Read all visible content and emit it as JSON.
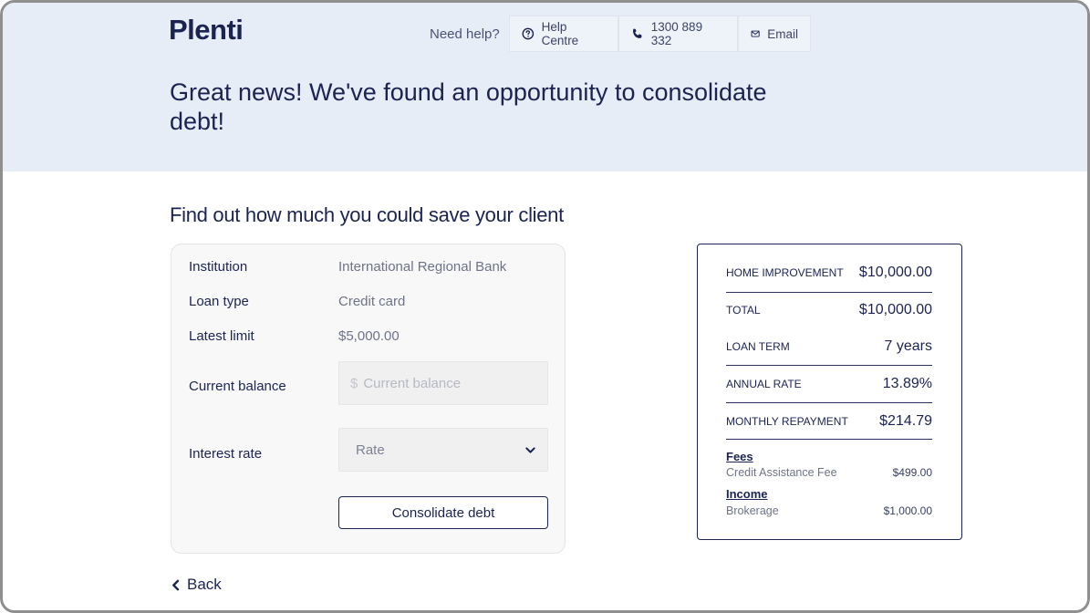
{
  "brand": {
    "logo": "Plenti"
  },
  "help": {
    "label": "Need help?",
    "help_centre": "Help Centre",
    "phone": "1300 889 332",
    "email": "Email"
  },
  "hero": {
    "title": "Great news! We've found an opportunity to consolidate debt!"
  },
  "section": {
    "title": "Find out how much you could save your client"
  },
  "form": {
    "institution_label": "Institution",
    "institution_value": "International Regional Bank",
    "loan_type_label": "Loan type",
    "loan_type_value": "Credit card",
    "latest_limit_label": "Latest limit",
    "latest_limit_value": "$5,000.00",
    "current_balance_label": "Current balance",
    "current_balance_prefix": "$",
    "current_balance_placeholder": "Current balance",
    "interest_rate_label": "Interest rate",
    "interest_rate_selected": "Rate",
    "consolidate_label": "Consolidate debt"
  },
  "back": {
    "label": "Back"
  },
  "summary": {
    "rows": [
      {
        "label": "HOME IMPROVEMENT",
        "value": "$10,000.00"
      },
      {
        "label": "TOTAL",
        "value": "$10,000.00"
      },
      {
        "label": "LOAN TERM",
        "value": "7 years"
      },
      {
        "label": "ANNUAL RATE",
        "value": "13.89%"
      },
      {
        "label": "MONTHLY REPAYMENT",
        "value": "$214.79"
      }
    ],
    "fees_heading": "Fees",
    "fees": [
      {
        "label": "Credit Assistance Fee",
        "value": "$499.00"
      }
    ],
    "income_heading": "Income",
    "income": [
      {
        "label": "Brokerage",
        "value": "$1,000.00"
      }
    ]
  },
  "icons": {
    "help": "question-circle-icon",
    "phone": "phone-icon",
    "email": "envelope-icon",
    "dropdown": "chevron-down-icon",
    "back": "chevron-left-icon"
  },
  "colors": {
    "navy": "#1b2352",
    "hero_bg": "#e7edf6"
  }
}
